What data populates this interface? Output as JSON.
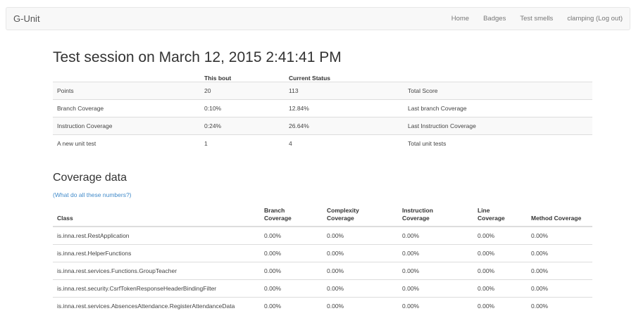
{
  "nav": {
    "brand": "G-Unit",
    "links": [
      "Home",
      "Badges",
      "Test smells",
      "clamping (Log out)"
    ]
  },
  "page_title": "Test session on March 12, 2015 2:41:41 PM",
  "summary": {
    "headers": [
      "",
      "This bout",
      "Current Status",
      ""
    ],
    "rows": [
      [
        "Points",
        "20",
        "113",
        "Total Score"
      ],
      [
        "Branch Coverage",
        "0:10%",
        "12.84%",
        "Last branch Coverage"
      ],
      [
        "Instruction Coverage",
        "0:24%",
        "26.64%",
        "Last Instruction Coverage"
      ],
      [
        "A new unit test",
        "1",
        "4",
        "Total unit tests"
      ]
    ]
  },
  "coverage": {
    "title": "Coverage data",
    "help_link": "(What do all these numbers?)",
    "headers": [
      [
        "Class"
      ],
      [
        "Branch",
        "Coverage"
      ],
      [
        "Complexity",
        "Coverage"
      ],
      [
        "Instruction",
        "Coverage"
      ],
      [
        "Line",
        "Coverage"
      ],
      [
        "Method Coverage"
      ]
    ],
    "rows": [
      [
        "is.inna.rest.RestApplication",
        "0.00%",
        "0.00%",
        "0.00%",
        "0.00%",
        "0.00%"
      ],
      [
        "is.inna.rest.HelperFunctions",
        "0.00%",
        "0.00%",
        "0.00%",
        "0.00%",
        "0.00%"
      ],
      [
        "is.inna.rest.services.Functions.GroupTeacher",
        "0.00%",
        "0.00%",
        "0.00%",
        "0.00%",
        "0.00%"
      ],
      [
        "is.inna.rest.security.CsrfTokenResponseHeaderBindingFilter",
        "0.00%",
        "0.00%",
        "0.00%",
        "0.00%",
        "0.00%"
      ],
      [
        "is.inna.rest.services.AbsencesAttendance.RegisterAttendanceData",
        "0.00%",
        "0.00%",
        "0.00%",
        "0.00%",
        "0.00%"
      ]
    ]
  }
}
